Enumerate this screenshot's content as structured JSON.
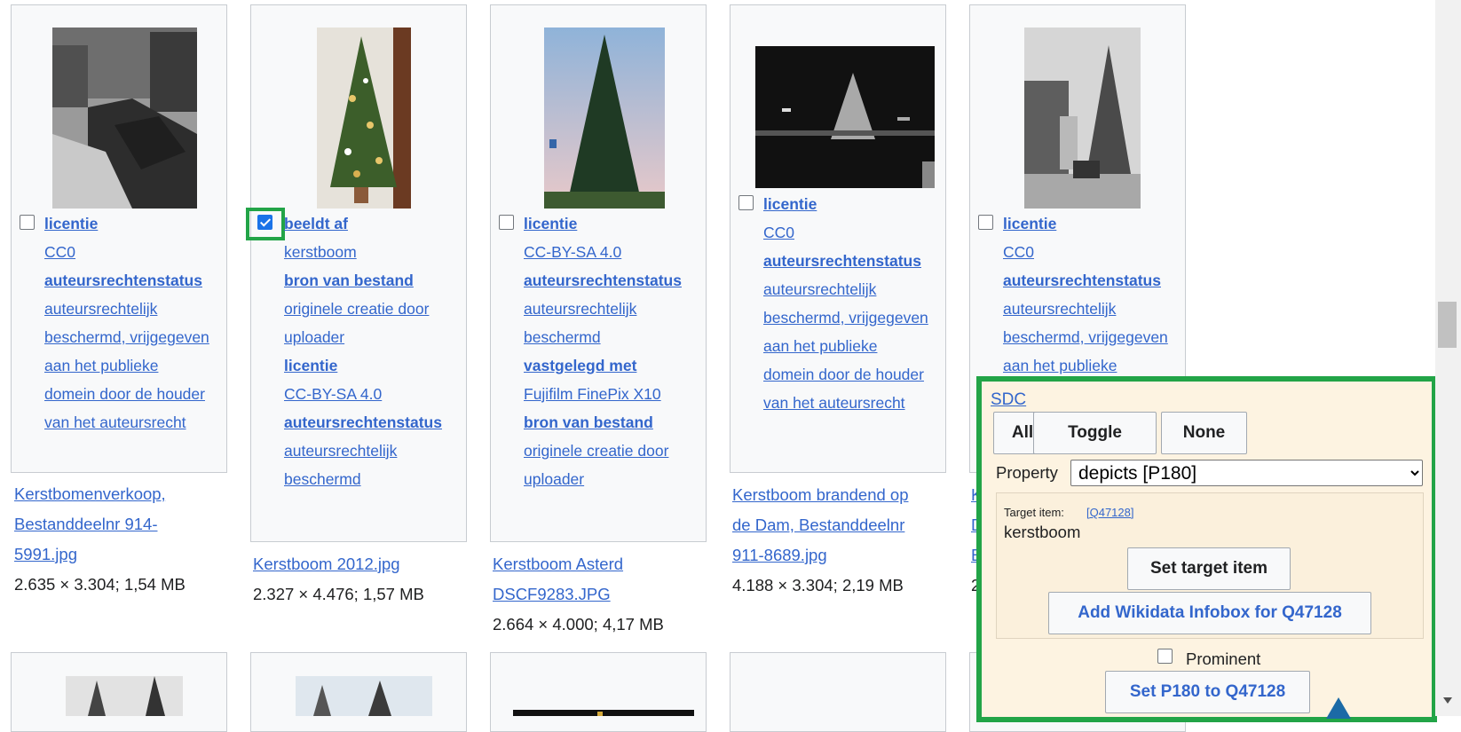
{
  "tiles": [
    {
      "checked": false,
      "metadata": [
        {
          "text": "licentie",
          "bold": true
        },
        {
          "text": "CC0"
        },
        {
          "text": "auteursrechtenstatus",
          "bold": true
        },
        {
          "text": "auteursrechtelijk"
        },
        {
          "text": "beschermd, vrijgegeven"
        },
        {
          "text": "aan het publieke"
        },
        {
          "text": "domein door de houder"
        },
        {
          "text": "van het auteursrecht"
        }
      ],
      "caption_lines": [
        "Kerstbomenverkoop,",
        "Bestanddeelnr 914-",
        "5991.jpg"
      ],
      "size": "2.635 × 3.304; 1,54 MB"
    },
    {
      "checked": true,
      "metadata": [
        {
          "text": "beeldt af",
          "bold": true
        },
        {
          "text": "kerstboom"
        },
        {
          "text": "bron van bestand",
          "bold": true
        },
        {
          "text": "originele creatie door"
        },
        {
          "text": "uploader"
        },
        {
          "text": "licentie",
          "bold": true
        },
        {
          "text": "CC-BY-SA 4.0"
        },
        {
          "text": "auteursrechtenstatus",
          "bold": true
        },
        {
          "text": "auteursrechtelijk"
        },
        {
          "text": "beschermd"
        }
      ],
      "caption_lines": [
        "Kerstboom 2012.jpg"
      ],
      "size": "2.327 × 4.476; 1,57 MB"
    },
    {
      "checked": false,
      "metadata": [
        {
          "text": "licentie",
          "bold": true
        },
        {
          "text": "CC-BY-SA 4.0"
        },
        {
          "text": "auteursrechtenstatus",
          "bold": true
        },
        {
          "text": "auteursrechtelijk"
        },
        {
          "text": "beschermd"
        },
        {
          "text": "vastgelegd met",
          "bold": true
        },
        {
          "text": "Fujifilm FinePix X10"
        },
        {
          "text": "bron van bestand",
          "bold": true
        },
        {
          "text": "originele creatie door"
        },
        {
          "text": "uploader"
        }
      ],
      "caption_lines": [
        "Kerstboom Asterd",
        "DSCF9283.JPG"
      ],
      "size": "2.664 × 4.000; 4,17 MB"
    },
    {
      "checked": false,
      "metadata": [
        {
          "text": "licentie",
          "bold": true
        },
        {
          "text": "CC0"
        },
        {
          "text": "auteursrechtenstatus",
          "bold": true
        },
        {
          "text": "auteursrechtelijk"
        },
        {
          "text": "beschermd, vrijgegeven"
        },
        {
          "text": "aan het publieke"
        },
        {
          "text": "domein door de houder"
        },
        {
          "text": "van het auteursrecht"
        }
      ],
      "caption_lines": [
        "Kerstboom brandend op",
        "de Dam, Bestanddeelnr",
        "911-8689.jpg"
      ],
      "size": "4.188 × 3.304; 2,19 MB"
    },
    {
      "checked": false,
      "metadata": [
        {
          "text": "licentie",
          "bold": true
        },
        {
          "text": "CC0"
        },
        {
          "text": "auteursrechtenstatus",
          "bold": true
        },
        {
          "text": "auteursrechtelijk"
        },
        {
          "text": "beschermd, vrijgegeven"
        },
        {
          "text": "aan het publieke"
        }
      ],
      "caption_lines": [
        "K",
        "D",
        "E"
      ],
      "size": "2"
    }
  ],
  "sdc_panel": {
    "title": "SDC",
    "all_label": "All",
    "toggle_label": "Toggle",
    "none_label": "None",
    "property_label": "Property",
    "property_value": "depicts [P180]",
    "target_item_label": "Target item:",
    "target_item_id": "[Q47128]",
    "target_item_name": "kerstboom",
    "set_target_label": "Set target item",
    "add_infobox_label": "Add Wikidata Infobox for Q47128",
    "prominent_label": "Prominent",
    "set_property_label": "Set P180 to Q47128"
  }
}
